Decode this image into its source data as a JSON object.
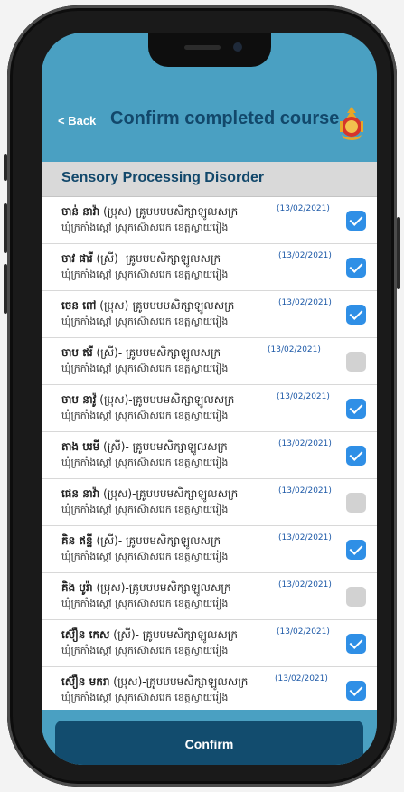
{
  "header": {
    "back_label": "< Back",
    "title": "Confirm completed course",
    "emblem_icon": "emblem-icon"
  },
  "course": {
    "title": "Sensory Processing Disorder"
  },
  "colors": {
    "screen_bg": "#4aa0c2",
    "title": "#12486b",
    "check_on": "#2f8fe6",
    "check_off": "#d2d2d2",
    "button": "#124c6e"
  },
  "participants": [
    {
      "name": "ចាន់ នាវ៉ា",
      "info": "(ប្រុស)-គ្រូបបបមសិក្សាឡូលសក្រ",
      "date": "(13/02/2021)",
      "location": "ឃុំក្រកាំងស្ដៅ ស្រុកស៊ោសរេក ខេត្តស្វាយរៀង",
      "checked": true
    },
    {
      "name": "ចាវ ផារី",
      "info": "(ស្រី)- គ្រូបបមសិក្សាឡូលសក្រ",
      "date": "(13/02/2021)",
      "location": "ឃុំក្រកាំងស្ដៅ ស្រុកស៊ោសរេក ខេត្តស្វាយរៀង",
      "checked": true
    },
    {
      "name": "ចេន ពៅ",
      "info": "(ប្រុស)-គ្រូបបបមសិក្សាឡូលសក្រ",
      "date": "(13/02/2021)",
      "location": "ឃុំក្រកាំងស្ដៅ ស្រុកស៊ោសរេក ខេត្តស្វាយរៀង",
      "checked": true
    },
    {
      "name": "ចាប ឥរី",
      "info": "(ស្រី)- គ្រូបបមសិក្សាឡូលសក្រ",
      "date": "(13/02/2021)",
      "location": "ឃុំក្រកាំងស្ដៅ ស្រុកស៊ោសរេក ខេត្តស្វាយរៀង",
      "checked": false
    },
    {
      "name": "ចាប នាវ៉ូ",
      "info": "(ប្រុស)-គ្រូបបបមសិក្សាឡូលសក្រ",
      "date": "(13/02/2021)",
      "location": "ឃុំក្រកាំងស្ដៅ ស្រុកស៊ោសរេក ខេត្តស្វាយរៀង",
      "checked": true
    },
    {
      "name": "តាង បរមី",
      "info": "(ស្រី)- គ្រូបបមសិក្សាឡូលសក្រ",
      "date": "(13/02/2021)",
      "location": "ឃុំក្រកាំងស្ដៅ ស្រុកស៊ោសរេក ខេត្តស្វាយរៀង",
      "checked": true
    },
    {
      "name": "ផេន នាវ៉ា",
      "info": "(ប្រុស)-គ្រូបបបមសិក្សាឡូលសក្រ",
      "date": "(13/02/2021)",
      "location": "ឃុំក្រកាំងស្ដៅ ស្រុកស៊ោសរេក ខេត្តស្វាយរៀង",
      "checked": false
    },
    {
      "name": "គិន ឥន្ទី",
      "info": "(ស្រី)- គ្រូបបមសិក្សាឡូលសក្រ",
      "date": "(13/02/2021)",
      "location": "ឃុំក្រកាំងស្ដៅ ស្រុកស៊ោសរេក ខេត្តស្វាយរៀង",
      "checked": true
    },
    {
      "name": "គិង បូរ៉ា",
      "info": "(ប្រុស)-គ្រូបបបមសិក្សាឡូលសក្រ",
      "date": "(13/02/2021)",
      "location": "ឃុំក្រកាំងស្ដៅ ស្រុកស៊ោសរេក ខេត្តស្វាយរៀង",
      "checked": false
    },
    {
      "name": "ស៊ឿន កេស",
      "info": "(ស្រី)- គ្រូបបមសិក្សាឡូលសក្រ",
      "date": "(13/02/2021)",
      "location": "ឃុំក្រកាំងស្ដៅ ស្រុកស៊ោសរេក ខេត្តស្វាយរៀង",
      "checked": true
    },
    {
      "name": "ស៊ឿន មករា",
      "info": "(ប្រុស)-គ្រូបបបមសិក្សាឡូលសក្រ",
      "date": "(13/02/2021)",
      "location": "ឃុំក្រកាំងស្ដៅ ស្រុកស៊ោសរេក ខេត្តស្វាយរៀង",
      "checked": true
    }
  ],
  "footer": {
    "confirm_label": "Confirm"
  }
}
